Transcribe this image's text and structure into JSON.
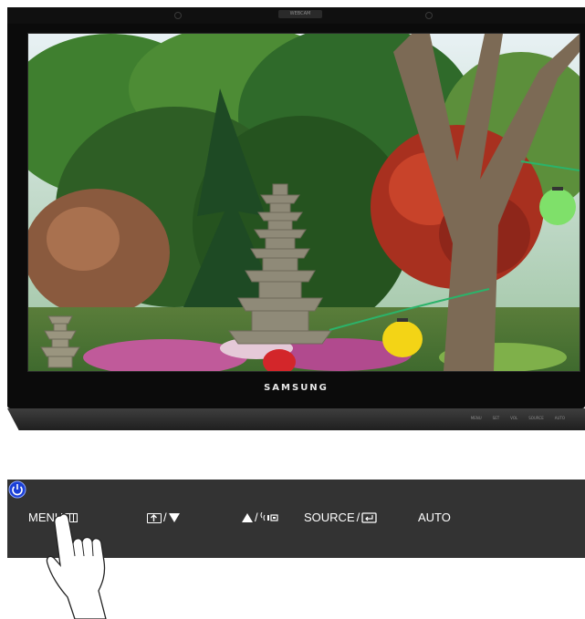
{
  "monitor": {
    "brand_name": "SAMSUNG",
    "webcam_label": "WEBCAM",
    "base_labels": [
      "MENU",
      "SET",
      "VOL",
      "SOURCE",
      "AUTO"
    ]
  },
  "controls": {
    "menu_label": "MENU",
    "menu_icon": "menu-grid-icon",
    "adjust_separator": "/",
    "adjust_icon": "picture-up-icon",
    "down_icon": "down-triangle-icon",
    "up_icon": "up-triangle-icon",
    "bright_separator": "/",
    "brightness_icon": "brightness-icon",
    "source_label": "SOURCE",
    "source_separator": "/",
    "enter_icon": "enter-icon",
    "auto_label": "AUTO",
    "power_icon": "power-icon",
    "power_color": "#1a3fd6"
  },
  "hand_icon": "pointing-hand-icon"
}
